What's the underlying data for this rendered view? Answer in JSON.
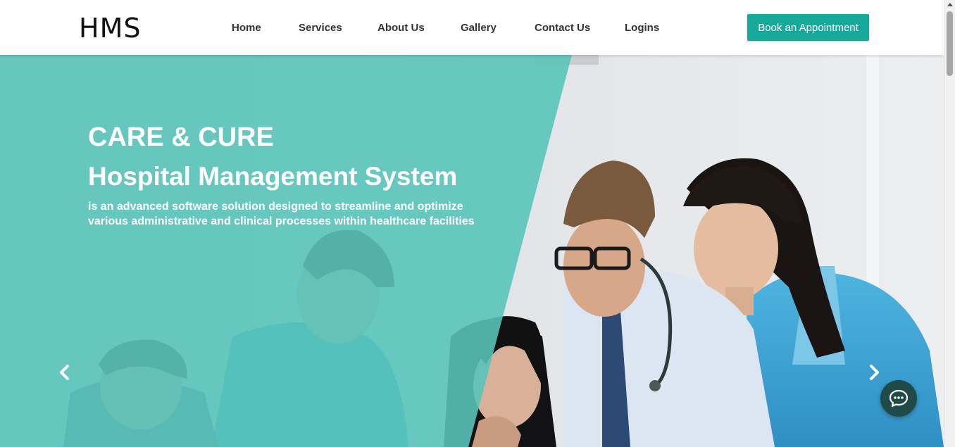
{
  "header": {
    "logo": "HMS",
    "nav": [
      {
        "label": "Home"
      },
      {
        "label": "Services"
      },
      {
        "label": "About Us"
      },
      {
        "label": "Gallery"
      },
      {
        "label": "Contact Us"
      },
      {
        "label": "Logins"
      }
    ],
    "cta_label": "Book an Appointment"
  },
  "hero": {
    "title": "CARE & CURE",
    "subtitle": "Hospital Management System",
    "description": "is an advanced software solution designed to streamline and optimize various administrative and clinical processes within healthcare facilities",
    "prev_icon": "chevron-left-icon",
    "next_icon": "chevron-right-icon"
  },
  "chat": {
    "icon": "chat-bubble-icon"
  },
  "colors": {
    "brand": "#17a99b",
    "overlay": "#5ec8be",
    "chat_bg": "#1f4a48"
  }
}
